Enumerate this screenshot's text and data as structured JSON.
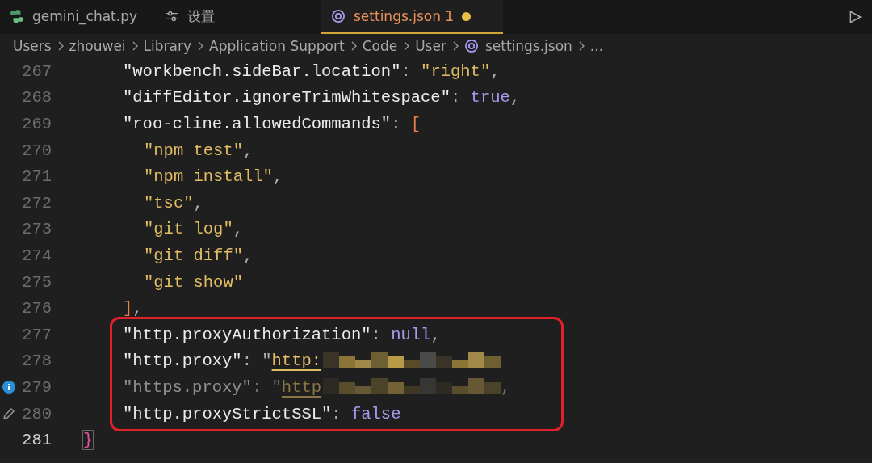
{
  "tabs": [
    {
      "label": "gemini_chat.py",
      "kind": "python",
      "selected": false,
      "modified": false
    },
    {
      "label": "设置",
      "kind": "sliders",
      "selected": false,
      "modified": false
    },
    {
      "label": "settings.json",
      "kind": "json",
      "selected": true,
      "modified": true,
      "problems": "1"
    }
  ],
  "breadcrumb": [
    {
      "label": "Users"
    },
    {
      "label": "zhouwei"
    },
    {
      "label": "Library"
    },
    {
      "label": "Application Support"
    },
    {
      "label": "Code"
    },
    {
      "label": "User"
    },
    {
      "label": "settings.json",
      "kind": "json"
    },
    {
      "label": "..."
    }
  ],
  "lines": [
    {
      "number": "267",
      "tokens": [
        {
          "kind": "key",
          "text": "\"workbench.sideBar.location\""
        },
        {
          "kind": "punct",
          "text": ": "
        },
        {
          "kind": "string",
          "text": "\"right\""
        },
        {
          "kind": "punct",
          "text": ","
        }
      ]
    },
    {
      "number": "268",
      "tokens": [
        {
          "kind": "key",
          "text": "\"diffEditor.ignoreTrimWhitespace\""
        },
        {
          "kind": "punct",
          "text": ": "
        },
        {
          "kind": "literal",
          "text": "true"
        },
        {
          "kind": "punct",
          "text": ","
        }
      ]
    },
    {
      "number": "269",
      "tokens": [
        {
          "kind": "key",
          "text": "\"roo-cline.allowedCommands\""
        },
        {
          "kind": "punct",
          "text": ": "
        },
        {
          "kind": "bracket",
          "text": "["
        }
      ],
      "children": [
        {
          "number": "270",
          "tokens": [
            {
              "kind": "string",
              "text": "\"npm test\""
            },
            {
              "kind": "punct",
              "text": ","
            }
          ]
        },
        {
          "number": "271",
          "tokens": [
            {
              "kind": "string",
              "text": "\"npm install\""
            },
            {
              "kind": "punct",
              "text": ","
            }
          ]
        },
        {
          "number": "272",
          "tokens": [
            {
              "kind": "string",
              "text": "\"tsc\""
            },
            {
              "kind": "punct",
              "text": ","
            }
          ]
        },
        {
          "number": "273",
          "tokens": [
            {
              "kind": "string",
              "text": "\"git log\""
            },
            {
              "kind": "punct",
              "text": ","
            }
          ]
        },
        {
          "number": "274",
          "tokens": [
            {
              "kind": "string",
              "text": "\"git diff\""
            },
            {
              "kind": "punct",
              "text": ","
            }
          ]
        },
        {
          "number": "275",
          "tokens": [
            {
              "kind": "string",
              "text": "\"git show\""
            }
          ]
        }
      ]
    },
    {
      "number": "276",
      "tokens": [
        {
          "kind": "bracket",
          "text": "]"
        },
        {
          "kind": "punct",
          "text": ","
        }
      ]
    },
    {
      "number": "277",
      "highlighted": true,
      "tokens": [
        {
          "kind": "key",
          "text": "\"http.proxyAuthorization\""
        },
        {
          "kind": "punct",
          "text": ": "
        },
        {
          "kind": "literal",
          "text": "null"
        },
        {
          "kind": "punct",
          "text": ","
        }
      ]
    },
    {
      "number": "278",
      "highlighted": true,
      "tokens": [
        {
          "kind": "key",
          "text": "\"http.proxy\""
        },
        {
          "kind": "punct",
          "text": ": "
        },
        {
          "kind": "punct",
          "text": "\""
        },
        {
          "kind": "link",
          "text": "http:"
        },
        {
          "kind": "redaction"
        }
      ]
    },
    {
      "number": "279",
      "highlighted": true,
      "dimmed": true,
      "kind": "info",
      "tokens": [
        {
          "kind": "key",
          "text": "\"https.proxy\""
        },
        {
          "kind": "punct",
          "text": ": "
        },
        {
          "kind": "punct",
          "text": "\""
        },
        {
          "kind": "link",
          "text": "http"
        },
        {
          "kind": "redaction"
        },
        {
          "kind": "punct",
          "text": ","
        }
      ]
    },
    {
      "number": "280",
      "highlighted": true,
      "kind": "edit",
      "tokens": [
        {
          "kind": "key",
          "text": "\"http.proxyStrictSSL\""
        },
        {
          "kind": "punct",
          "text": ": "
        },
        {
          "kind": "literal",
          "text": "false"
        }
      ]
    }
  ],
  "closing_line": {
    "number": "281",
    "text": "}",
    "current": true
  }
}
